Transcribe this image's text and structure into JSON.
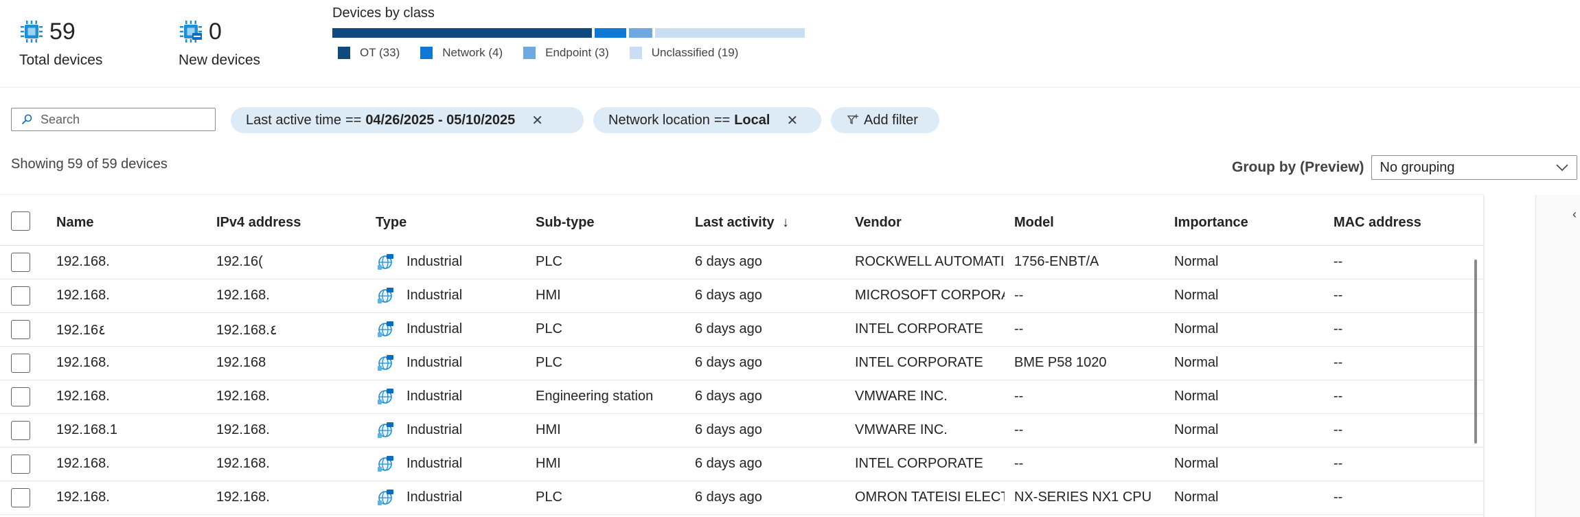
{
  "summary": {
    "total": {
      "count": "59",
      "label": "Total devices",
      "icon": "device-chip-icon"
    },
    "new": {
      "count": "0",
      "label": "New devices",
      "icon": "new-device-chip-icon"
    },
    "devices_by_class": {
      "title": "Devices by class",
      "classes": [
        {
          "label": "OT (33)",
          "count": 33,
          "color": "#0e4a7e"
        },
        {
          "label": "Network (4)",
          "count": 4,
          "color": "#0f78d4"
        },
        {
          "label": "Endpoint (3)",
          "count": 3,
          "color": "#6fa9e0"
        },
        {
          "label": "Unclassified (19)",
          "count": 19,
          "color": "#c9def3"
        }
      ]
    }
  },
  "filters": {
    "search_placeholder": "Search",
    "chips": [
      {
        "field": "Last active time",
        "op": "==",
        "value": "04/26/2025 - 05/10/2025"
      },
      {
        "field": "Network location",
        "op": "==",
        "value": "Local"
      }
    ],
    "add_filter_label": "Add filter",
    "remove_icon": "✕"
  },
  "status": {
    "showing": "Showing 59 of 59 devices",
    "group_by_label": "Group by (Preview)",
    "group_by_value": "No grouping"
  },
  "table": {
    "columns": [
      "Name",
      "IPv4 address",
      "Type",
      "Sub-type",
      "Last activity",
      "Vendor",
      "Model",
      "Importance",
      "MAC address"
    ],
    "sort_indicator": "↓",
    "rows": [
      {
        "name": "192.168.",
        "ip": "192.16(",
        "type": "Industrial",
        "subtype": "PLC",
        "last": "6 days ago",
        "vendor": "ROCKWELL AUTOMATI(",
        "model": "1756-ENBT/A",
        "importance": "Normal",
        "mac": "--"
      },
      {
        "name": "192.168.",
        "ip": "192.168.",
        "type": "Industrial",
        "subtype": "HMI",
        "last": "6 days ago",
        "vendor": "MICROSOFT CORPORA",
        "model": "--",
        "importance": "Normal",
        "mac": "--"
      },
      {
        "name": "192.16٤",
        "ip": "192.168.٤",
        "type": "Industrial",
        "subtype": "PLC",
        "last": "6 days ago",
        "vendor": "INTEL CORPORATE",
        "model": "--",
        "importance": "Normal",
        "mac": "--"
      },
      {
        "name": "192.168.",
        "ip": "192.168",
        "type": "Industrial",
        "subtype": "PLC",
        "last": "6 days ago",
        "vendor": "INTEL CORPORATE",
        "model": "BME P58 1020",
        "importance": "Normal",
        "mac": "--"
      },
      {
        "name": "192.168.",
        "ip": "192.168.",
        "type": "Industrial",
        "subtype": "Engineering station",
        "last": "6 days ago",
        "vendor": "VMWARE INC.",
        "model": "--",
        "importance": "Normal",
        "mac": "--"
      },
      {
        "name": "192.168.1",
        "ip": "192.168.",
        "type": "Industrial",
        "subtype": "HMI",
        "last": "6 days ago",
        "vendor": "VMWARE INC.",
        "model": "--",
        "importance": "Normal",
        "mac": "--"
      },
      {
        "name": "192.168.",
        "ip": "192.168.",
        "type": "Industrial",
        "subtype": "HMI",
        "last": "6 days ago",
        "vendor": "INTEL CORPORATE",
        "model": "--",
        "importance": "Normal",
        "mac": "--"
      },
      {
        "name": "192.168.",
        "ip": "192.168.",
        "type": "Industrial",
        "subtype": "PLC",
        "last": "6 days ago",
        "vendor": "OMRON TATEISI ELECTI",
        "model": "NX-SERIES NX1 CPU",
        "importance": "Normal",
        "mac": "--"
      }
    ]
  }
}
